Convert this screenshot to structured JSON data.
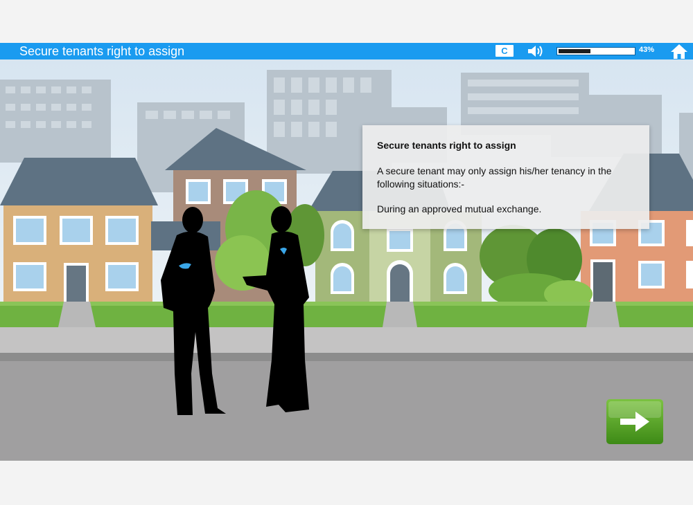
{
  "header": {
    "title": "Secure tenants right to assign",
    "captions_label": "C",
    "progress_percent": 43,
    "progress_label": "43%"
  },
  "infobox": {
    "title": "Secure tenants right to assign",
    "body": "A secure tenant may only assign his/her tenancy in the following situations:-",
    "exception": "During an approved mutual exchange."
  },
  "icons": {
    "captions": "captions-icon",
    "sound": "speaker-icon",
    "home": "home-icon",
    "next": "arrow-right-icon"
  },
  "colors": {
    "header_bar": "#1a9bf0",
    "next_button": "#4e9a1c",
    "sky": "#dbe8f3"
  }
}
